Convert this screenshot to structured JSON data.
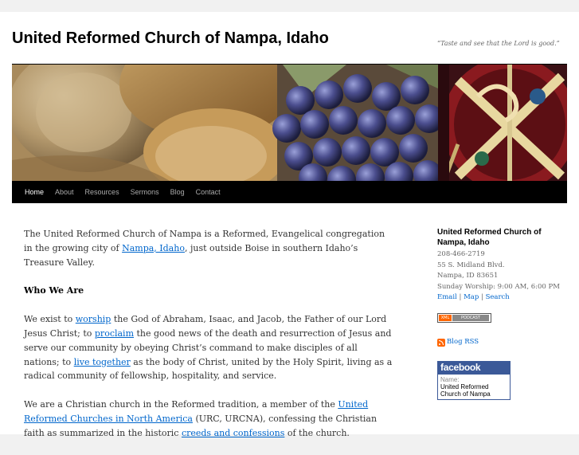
{
  "site": {
    "title": "United Reformed Church of Nampa, Idaho",
    "tagline": "“Taste and see that the Lord is good.”"
  },
  "nav": [
    {
      "label": "Home",
      "current": true
    },
    {
      "label": "About"
    },
    {
      "label": "Resources"
    },
    {
      "label": "Sermons"
    },
    {
      "label": "Blog"
    },
    {
      "label": "Contact"
    }
  ],
  "content": {
    "p1": {
      "before": "The United Reformed Church of Nampa is a Reformed, Evangelical congregation in the growing city of ",
      "link": "Nampa, Idaho",
      "after": ", just outside Boise in southern Idaho’s Treasure Valley."
    },
    "heading": "Who We Are",
    "p2": {
      "t1": "We exist to ",
      "l1": "worship",
      "t2": " the God of Abraham, Isaac, and Jacob, the Father of our Lord Jesus Christ; to ",
      "l2": "proclaim",
      "t3": " the good news of the death and resurrection of Jesus and serve our community by obeying Christ’s command to make disciples of all nations; to ",
      "l3": "live together",
      "t4": " as the body of Christ, united by the Holy Spirit, living as a radical community of fellowship, hospitality, and service."
    },
    "p3": {
      "t1": "We are a Christian church in the Reformed tradition, a member of the ",
      "l1": "United Reformed Churches in North America",
      "t2": " (URC, URCNA), confessing the Christian faith as summarized in the historic ",
      "l2": "creeds and confessions",
      "t3": " of the church."
    }
  },
  "sidebar": {
    "org_name": "United Reformed Church of Nampa, Idaho",
    "phone": "208-466-2719",
    "address1": "55 S. Midland Blvd.",
    "address2": "Nampa, ID 83651",
    "worship": "Sunday Worship: 9:00 AM, 6:00 PM",
    "links": [
      "Email",
      "Map",
      "Search"
    ],
    "podcast_badge": {
      "left": "XML",
      "right": "PODCAST"
    },
    "rss_label": "Blog RSS",
    "facebook": {
      "brand": "facebook",
      "name_label": "Name:",
      "name_value": "United Reformed Church of Nampa"
    }
  },
  "colors": {
    "link": "#0066cc",
    "nav_bg": "#000000",
    "facebook": "#3b5998",
    "rss": "#ff6600"
  },
  "icons": [
    "rss-icon"
  ]
}
